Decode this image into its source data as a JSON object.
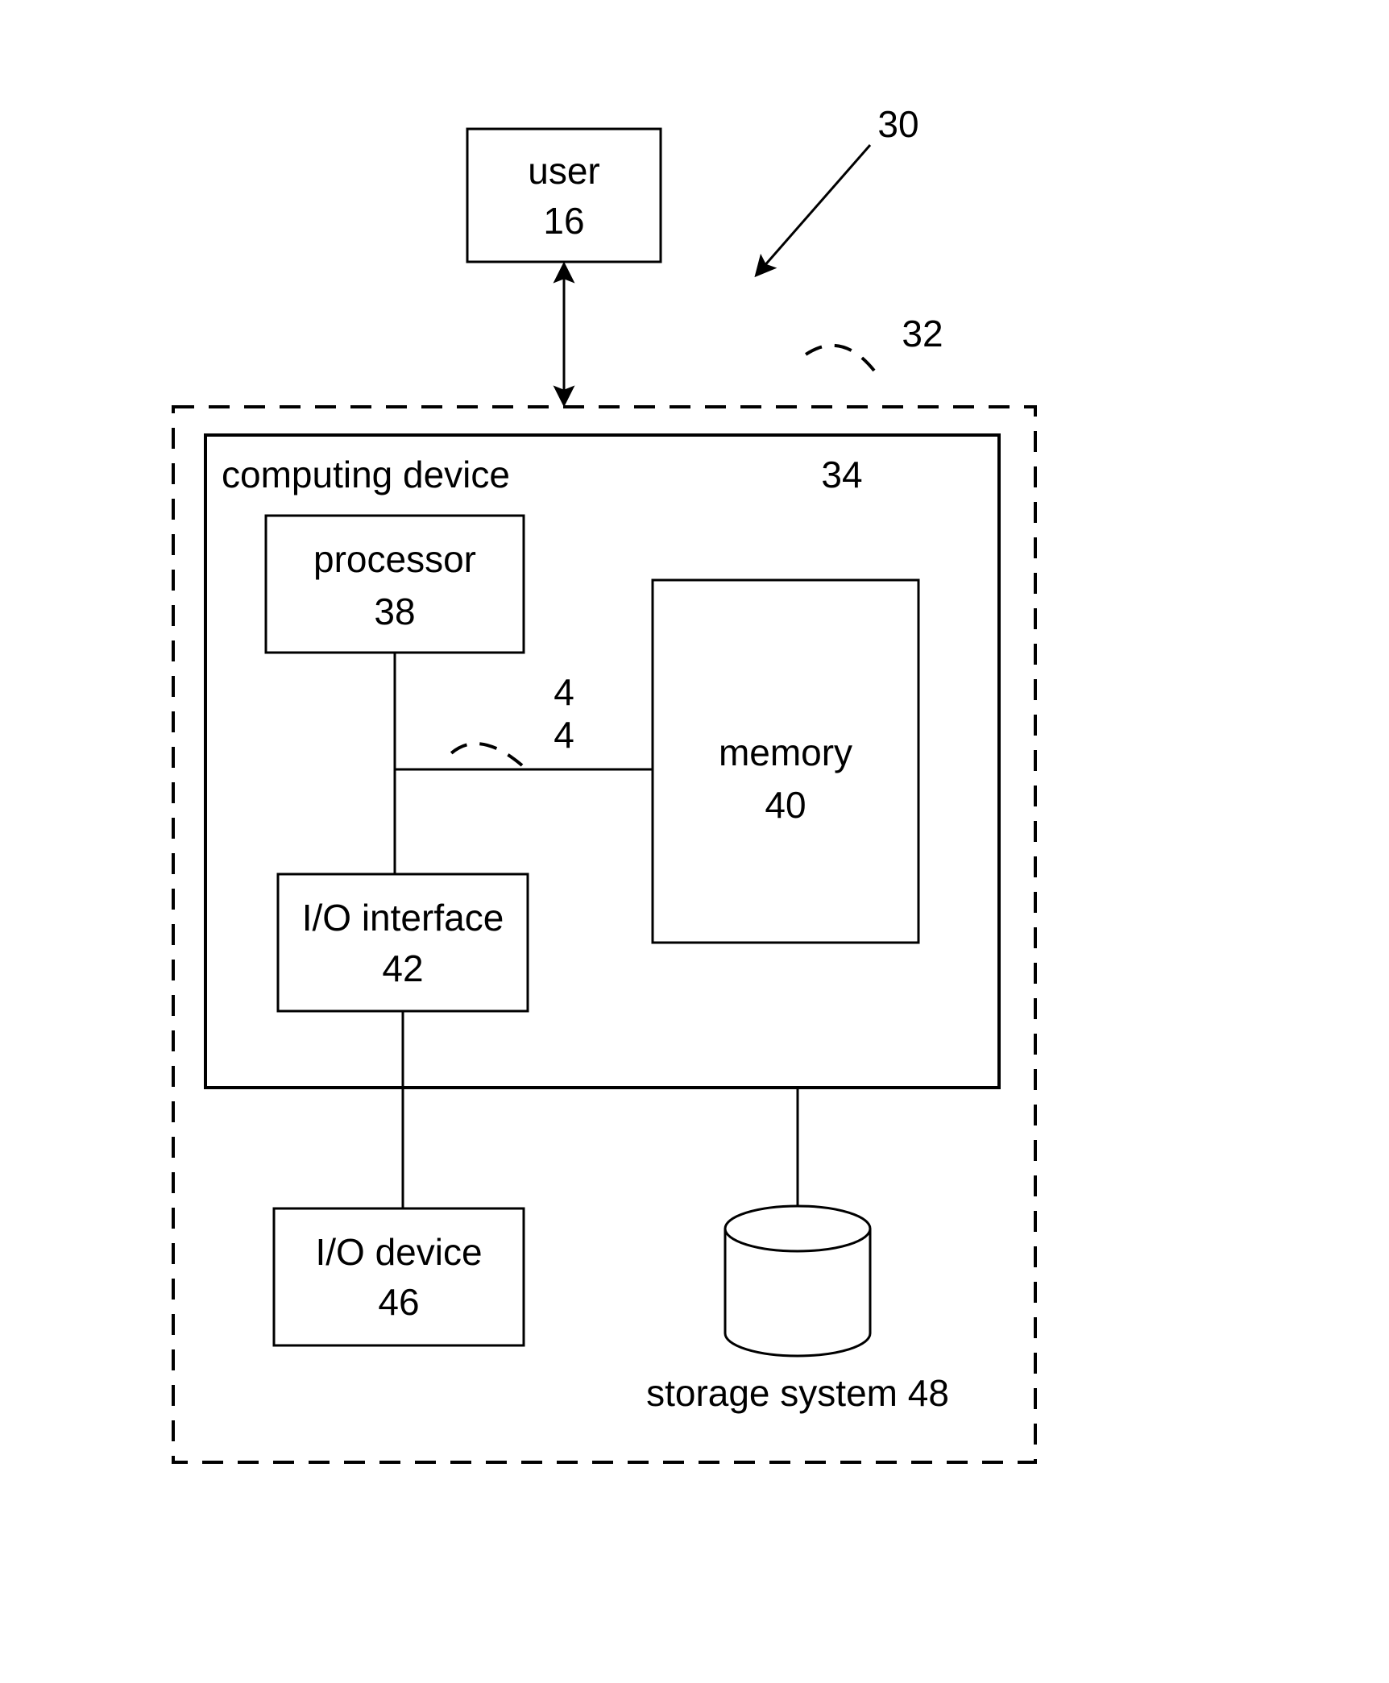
{
  "callouts": {
    "overall": "30",
    "dashed_box": "32",
    "bus": "4\n4"
  },
  "blocks": {
    "user": {
      "label": "user",
      "num": "16"
    },
    "computing_device": {
      "label": "computing device",
      "num": "34"
    },
    "processor": {
      "label": "processor",
      "num": "38"
    },
    "memory": {
      "label": "memory",
      "num": "40"
    },
    "io_interface": {
      "label": "I/O interface",
      "num": "42"
    },
    "io_device": {
      "label": "I/O device",
      "num": "46"
    },
    "storage": {
      "label": "storage system 48"
    }
  }
}
